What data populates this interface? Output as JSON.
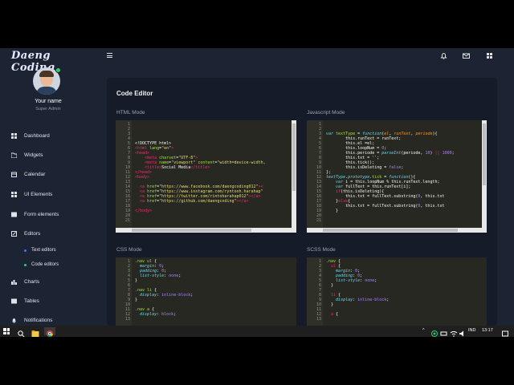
{
  "brand": "Daeng Coding",
  "user": {
    "name": "Your name",
    "role": "Super Admin"
  },
  "sidebar": {
    "items": [
      {
        "label": "Dashboard"
      },
      {
        "label": "Widgets"
      },
      {
        "label": "Calendar"
      },
      {
        "label": "UI Elements"
      },
      {
        "label": "Form elements"
      },
      {
        "label": "Editors"
      },
      {
        "label": "Charts"
      },
      {
        "label": "Tables"
      },
      {
        "label": "Notifications"
      }
    ],
    "sub_items": [
      {
        "label": "Text editors",
        "dot_color": "#5b6bf0"
      },
      {
        "label": "Code editors",
        "dot_color": "#2ecc71"
      }
    ]
  },
  "topbar": {
    "icons": [
      "hamburger-icon",
      "bell-icon",
      "mail-icon",
      "grid-icon"
    ]
  },
  "page": {
    "title": "Code Editor"
  },
  "panels": {
    "html": {
      "label": "HTML Mode"
    },
    "js": {
      "label": "Javascript Mode"
    },
    "css": {
      "label": "CSS Mode"
    },
    "scss": {
      "label": "SCSS Mode"
    }
  },
  "colors": {
    "background": "#1c2333",
    "card": "#151b28",
    "editor": "#272822",
    "accent_green": "#2ecc71"
  },
  "taskbar": {
    "language": "IND",
    "time": "13:17"
  }
}
